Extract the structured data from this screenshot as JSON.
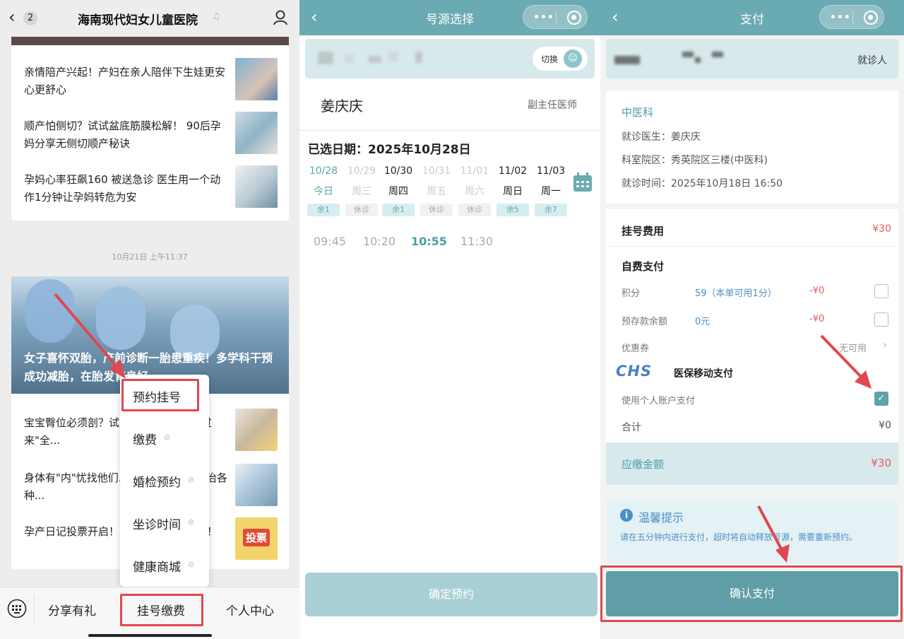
{
  "p1": {
    "back_count": "2",
    "title": "海南现代妇女儿童医院",
    "news_top": [
      {
        "text": "亲情陪产兴起！产妇在亲人陪伴下生娃更安心更舒心"
      },
      {
        "text": "顺产怕侧切？试试盆底筋膜松解！ 90后孕妈分享无侧切顺产秘诀"
      },
      {
        "text": "孕妈心率狂飙160 被送急诊  医生用一个动作1分钟让孕妈转危为安"
      }
    ],
    "timestamp": "10月21日 上午11:37",
    "banner_text": "女子喜怀双胎，产前诊断一胎患重疾！多学科干预成功减胎，在胎发育良好",
    "news_bottom": [
      {
        "text": "宝宝臀位必须剖？试... ！孕妈亲述\"转过来\"全..."
      },
      {
        "text": "身体有\"内\"忧找他们... 妇儿医院内科专治各种..."
      },
      {
        "text": "孕产日记投票开启！... 定千元大奖归属！"
      }
    ],
    "vote_thumb": "投票",
    "menu": [
      "预约挂号",
      "缴费",
      "婚检预约",
      "坐诊时间",
      "健康商城"
    ],
    "tabs": [
      "分享有礼",
      "挂号缴费",
      "个人中心"
    ]
  },
  "p2": {
    "title": "号源选择",
    "switch_label": "切换",
    "doctor_name": "姜庆庆",
    "doctor_title": "副主任医师",
    "selected_date": "已选日期：2025年10月28日",
    "dates": [
      {
        "d": "10/28",
        "w": "今日",
        "s": "余1",
        "state": "today"
      },
      {
        "d": "10/29",
        "w": "周三",
        "s": "休诊",
        "state": "off"
      },
      {
        "d": "10/30",
        "w": "周四",
        "s": "余1",
        "state": "avail"
      },
      {
        "d": "10/31",
        "w": "周五",
        "s": "休诊",
        "state": "off"
      },
      {
        "d": "11/01",
        "w": "周六",
        "s": "休诊",
        "state": "off"
      },
      {
        "d": "11/02",
        "w": "周日",
        "s": "余5",
        "state": "avail"
      },
      {
        "d": "11/03",
        "w": "周一",
        "s": "余7",
        "state": "avail"
      }
    ],
    "times": [
      {
        "t": "09:45",
        "state": "off"
      },
      {
        "t": "10:20",
        "state": "off"
      },
      {
        "t": "10:55",
        "state": "on"
      },
      {
        "t": "11:30",
        "state": "off"
      }
    ],
    "confirm": "确定预约"
  },
  "p3": {
    "title": "支付",
    "patient_label": "就诊人",
    "dept": "中医科",
    "doctor": "就诊医生：姜庆庆",
    "location": "科室院区：秀英院区三楼(中医科)",
    "visit_time": "就诊时间：2025年10月18日 16:50",
    "fee_label": "挂号费用",
    "fee_value": "¥30",
    "self_pay": "自费支付",
    "points_label": "积分",
    "points_value": "59（本单可用1分）",
    "points_deduct": "-¥0",
    "deposit_label": "预存款余额",
    "deposit_value": "0元",
    "deposit_deduct": "-¥0",
    "coupon_label": "优惠券",
    "coupon_value": "无可用",
    "chs_logo": "CHS",
    "insurance_title": "医保移动支付",
    "insurance_option": "使用个人账户支付",
    "total_label": "合计",
    "total_value": "¥0",
    "due_label": "应缴金额",
    "due_value": "¥30",
    "tip_title": "温馨提示",
    "tip_text": "请在五分钟内进行支付，超时将自动释放号源，需要重新预约。",
    "pay_button": "确认支付"
  },
  "colors": {
    "teal": "#6aaab2",
    "red": "#e0474f",
    "price_red": "#e05a5a",
    "blue": "#4a8fc9"
  }
}
